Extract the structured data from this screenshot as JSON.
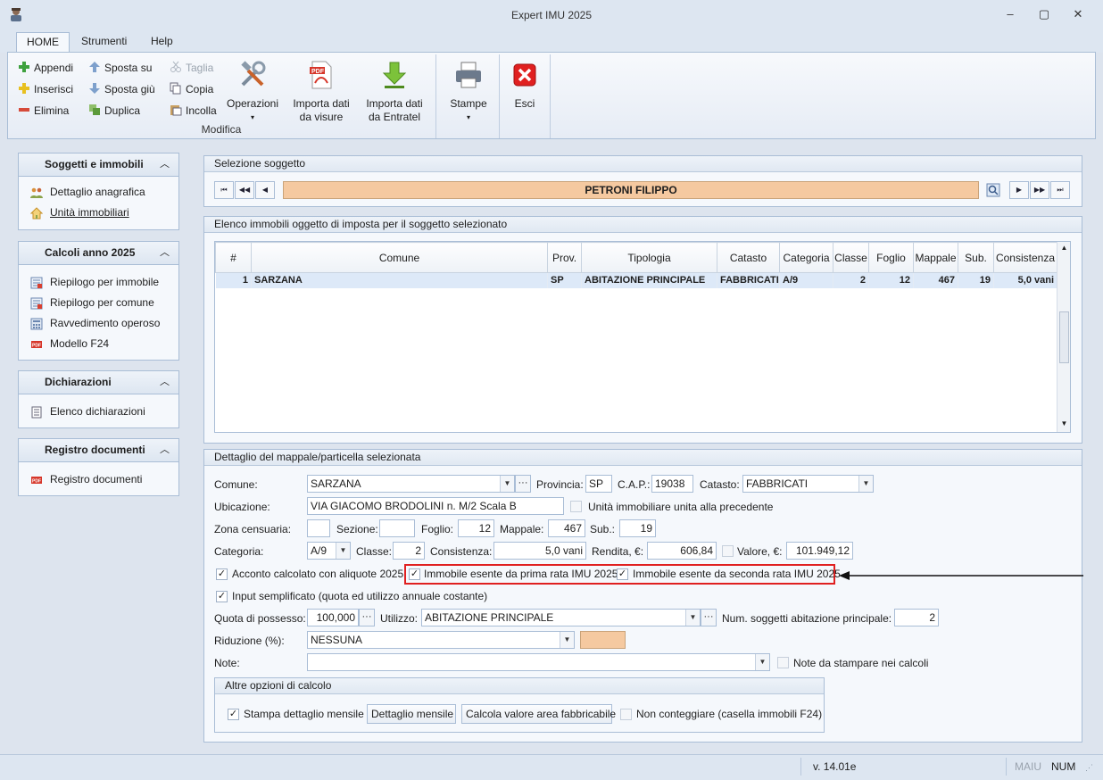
{
  "window": {
    "title": "Expert IMU 2025",
    "minimize": "‒",
    "maximize": "▢",
    "close": "✕"
  },
  "menu_tabs": [
    "HOME",
    "Strumenti",
    "Help"
  ],
  "ribbon": {
    "append": "Appendi",
    "insert": "Inserisci",
    "delete": "Elimina",
    "move_up": "Sposta su",
    "move_down": "Sposta giù",
    "duplicate": "Duplica",
    "cut": "Taglia",
    "copy": "Copia",
    "paste": "Incolla",
    "operations": "Operazioni",
    "import_visure_1": "Importa dati",
    "import_visure_2": "da visure",
    "import_entratel_1": "Importa dati",
    "import_entratel_2": "da Entratel",
    "group_modifica": "Modifica",
    "print": "Stampe",
    "exit": "Esci"
  },
  "sidebar": [
    {
      "title": "Soggetti e immobili",
      "items": [
        "Dettaglio anagrafica",
        "Unità immobiliari"
      ]
    },
    {
      "title": "Calcoli anno 2025",
      "items": [
        "Riepilogo per immobile",
        "Riepilogo per comune",
        "Ravvedimento operoso",
        "Modello F24"
      ]
    },
    {
      "title": "Dichiarazioni",
      "items": [
        "Elenco dichiarazioni"
      ]
    },
    {
      "title": "Registro documenti",
      "items": [
        "Registro documenti"
      ]
    }
  ],
  "selection": {
    "header": "Selezione soggetto",
    "name": "PETRONI FILIPPO"
  },
  "list": {
    "header": "Elenco immobili oggetto di imposta per il soggetto selezionato",
    "columns": [
      "#",
      "Comune",
      "Prov.",
      "Tipologia",
      "Catasto",
      "Categoria",
      "Classe",
      "Foglio",
      "Mappale",
      "Sub.",
      "Consistenza"
    ],
    "rows": [
      [
        "1",
        "SARZANA",
        "SP",
        "ABITAZIONE PRINCIPALE",
        "FABBRICATI",
        "A/9",
        "2",
        "12",
        "467",
        "19",
        "5,0 vani"
      ]
    ]
  },
  "detail": {
    "header": "Dettaglio del mappale/particella selezionata",
    "comune_label": "Comune:",
    "comune": "SARZANA",
    "provincia_label": "Provincia:",
    "provincia": "SP",
    "cap_label": "C.A.P.:",
    "cap": "19038",
    "catasto_label": "Catasto:",
    "catasto": "FABBRICATI",
    "ubicazione_label": "Ubicazione:",
    "ubicazione": "VIA GIACOMO BRODOLINI n. M/2  Scala B",
    "unita_unita_label": "Unità immobiliare unita alla precedente",
    "zona_label": "Zona censuaria:",
    "zona": "",
    "sezione_label": "Sezione:",
    "sezione": "",
    "foglio_label": "Foglio:",
    "foglio": "12",
    "mappale_label": "Mappale:",
    "mappale": "467",
    "sub_label": "Sub.:",
    "sub": "19",
    "categoria_label": "Categoria:",
    "categoria": "A/9",
    "classe_label": "Classe:",
    "classe": "2",
    "consistenza_label": "Consistenza:",
    "consistenza": "5,0 vani",
    "rendita_label": "Rendita, €:",
    "rendita": "606,84",
    "valore_label": "Valore, €:",
    "valore": "101.949,12",
    "acconto_label": "Acconto calcolato con aliquote 2025",
    "esente_prima_label": "Immobile esente da prima rata IMU 2025",
    "esente_seconda_label": "Immobile esente da seconda rata IMU 2025",
    "input_semplificato_label": "Input semplificato (quota ed utilizzo annuale costante)",
    "quota_label": "Quota di possesso:",
    "quota": "100,000",
    "utilizzo_label": "Utilizzo:",
    "utilizzo": "ABITAZIONE PRINCIPALE",
    "num_soggetti_label": "Num. soggetti abitazione principale:",
    "num_soggetti": "2",
    "riduzione_label": "Riduzione (%):",
    "riduzione": "NESSUNA",
    "note_label": "Note:",
    "note": "",
    "note_stampa_label": "Note da stampare nei calcoli",
    "altre_opzioni_header": "Altre opzioni di calcolo",
    "stampa_dettaglio_label": "Stampa dettaglio mensile",
    "dettaglio_mensile_button": "Dettaglio mensile",
    "calcola_area_button": "Calcola valore area fabbricabile",
    "non_conteggiare_label": "Non conteggiare (casella immobili F24)"
  },
  "status": {
    "version": "v. 14.01e",
    "maiu": "MAIU",
    "num": "NUM"
  },
  "colors": {
    "accent_red": "#e02020",
    "selected_name_bg": "#f5c9a0",
    "row_selected_bg": "#dde9f8"
  }
}
